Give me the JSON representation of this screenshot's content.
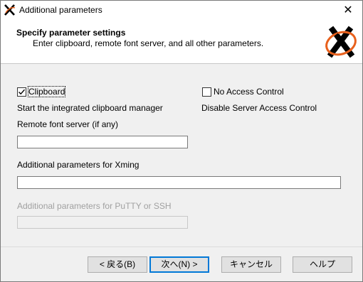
{
  "window": {
    "title": "Additional parameters",
    "close_glyph": "✕"
  },
  "header": {
    "title": "Specify parameter settings",
    "subtitle": "Enter clipboard, remote font server, and all other parameters.",
    "logo_icon": "xming-x-logo"
  },
  "clipboard": {
    "label": "Clipboard",
    "checked": true,
    "description": "Start the integrated clipboard manager"
  },
  "no_access_control": {
    "label": "No Access Control",
    "checked": false,
    "description": "Disable Server Access Control"
  },
  "remote_font_server": {
    "label": "Remote font server (if any)",
    "value": ""
  },
  "xming_params": {
    "label": "Additional parameters for Xming",
    "value": ""
  },
  "putty_params": {
    "label": "Additional parameters for PuTTY or SSH",
    "value": "",
    "enabled": false
  },
  "buttons": {
    "back": "< 戻る(B)",
    "next": "次へ(N) >",
    "cancel": "キャンセル",
    "help": "ヘルプ"
  },
  "colors": {
    "accent": "#0078d7",
    "logo_orange": "#e8601c",
    "disabled_text": "#a0a0a0"
  }
}
